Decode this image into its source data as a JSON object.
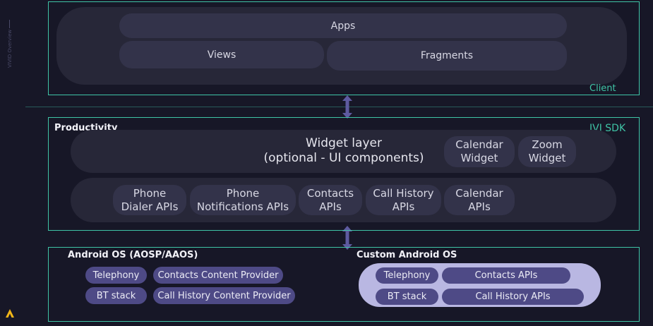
{
  "side": {
    "label": "VIVID Overview"
  },
  "client": {
    "label": "Client",
    "apps": "Apps",
    "views": "Views",
    "fragments": "Fragments"
  },
  "sdk": {
    "title": "Productivity",
    "label": "IVI SDK",
    "widget_layer": {
      "line1": "Widget layer",
      "line2": "(optional - UI components)"
    },
    "widgets": [
      {
        "line1": "Calendar",
        "line2": "Widget"
      },
      {
        "line1": "Zoom",
        "line2": "Widget"
      }
    ],
    "apis": [
      {
        "line1": "Phone",
        "line2": "Dialer APIs"
      },
      {
        "line1": "Phone",
        "line2": "Notifications APIs"
      },
      {
        "line1": "Contacts",
        "line2": "APIs"
      },
      {
        "line1": "Call History",
        "line2": "APIs"
      },
      {
        "line1": "Calendar",
        "line2": "APIs"
      }
    ]
  },
  "android": {
    "title": "Android OS (AOSP/AAOS)",
    "items": [
      "Telephony",
      "Contacts Content Provider",
      "BT stack",
      "Call History Content Provider"
    ]
  },
  "custom": {
    "title": "Custom Android OS",
    "items": [
      "Telephony",
      "Contacts APIs",
      "BT stack",
      "Call History APIs"
    ]
  },
  "colors": {
    "accent": "#3fc4a6",
    "purple": "#4e4a86",
    "lavender": "#b9b7e2",
    "background": "#171727"
  }
}
